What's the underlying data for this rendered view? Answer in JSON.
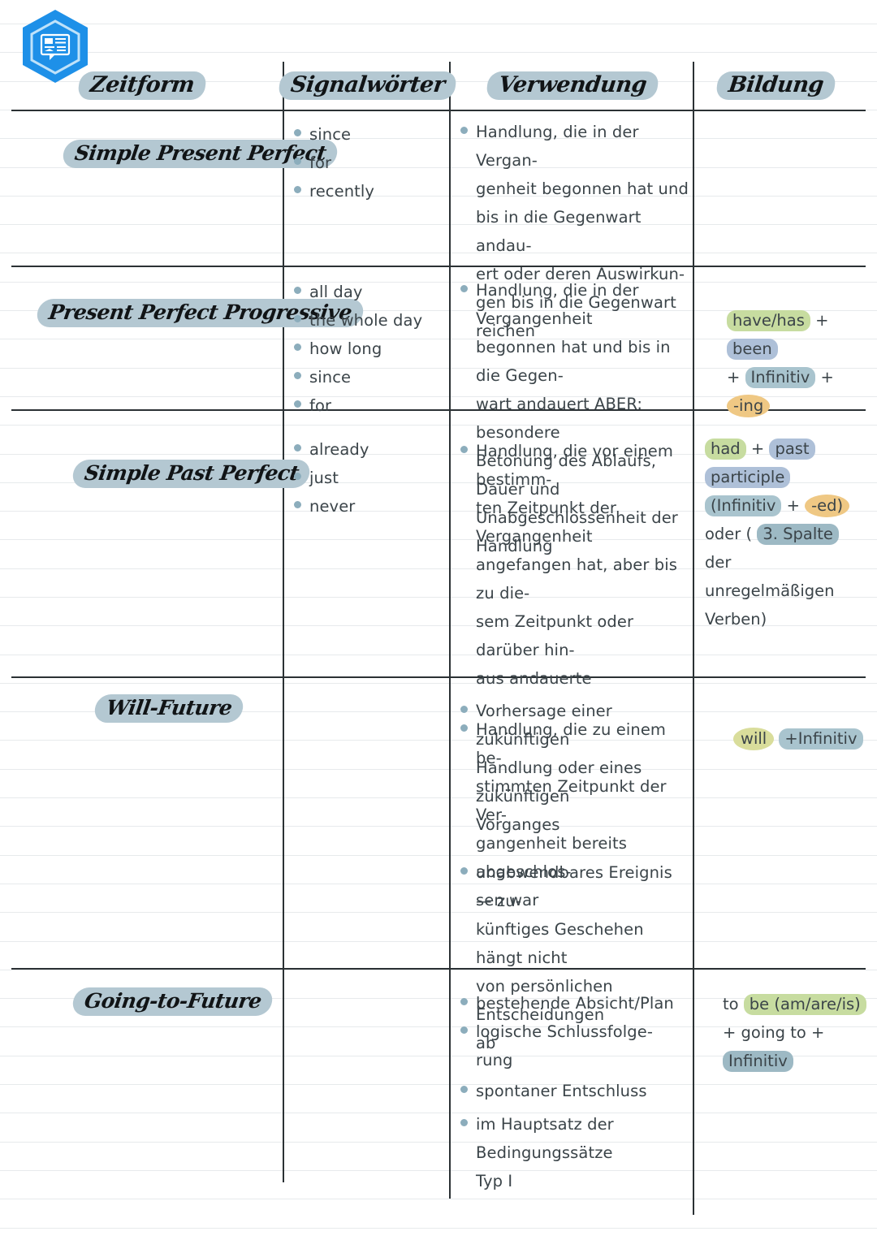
{
  "logo": {
    "icon": "hexagon-note-icon",
    "color": "#1e90e8"
  },
  "table": {
    "headers": [
      {
        "label": "Zeitform"
      },
      {
        "label": "Signalwörter"
      },
      {
        "label": "Verwendung"
      },
      {
        "label": "Bildung"
      }
    ],
    "rows": [
      {
        "tense": "Simple Present Perfect",
        "signalwoerter": [
          "since",
          "for",
          "recently"
        ],
        "verwendung": [
          "Handlung, die in der Vergan-\ngenheit begonnen hat und\nbis in die Gegenwart andau-\nert oder deren Auswirkun-\ngen bis in die Gegenwart\nreichen"
        ],
        "bildung": []
      },
      {
        "tense": "Present Perfect Progressive",
        "signalwoerter": [
          "all day",
          "the whole day",
          "how long",
          "since",
          "for"
        ],
        "verwendung": [
          "Handlung, die in der Vergangenheit\nbegonnen hat und bis in die Gegen-\nwart andauert ABER: besondere\nBetonung des Ablaufs, Dauer und\nUnabgeschlossenheit der Handlung"
        ],
        "bildung": [
          [
            {
              "text": "have/has",
              "hl": "green"
            },
            {
              "text": "+",
              "hl": "none"
            },
            {
              "text": "been",
              "hl": "blue"
            }
          ],
          [
            {
              "text": "+",
              "hl": "none"
            },
            {
              "text": "Infinitiv",
              "hl": "steel"
            },
            {
              "text": "+",
              "hl": "none"
            },
            {
              "text": "-ing",
              "hl": "orange"
            }
          ]
        ]
      },
      {
        "tense": "Simple Past Perfect",
        "signalwoerter": [
          "already",
          "just",
          "never"
        ],
        "verwendung": [
          "Handlung, die vor einem bestimm-\nten Zeitpunkt der Vergangenheit\nangefangen hat, aber bis zu die-\nsem Zeitpunkt oder darüber hin-\naus andauerte",
          "Handlung, die zu einem be-\nstimmten Zeitpunkt der Ver-\ngangenheit bereits abgeschlos-\nsen war"
        ],
        "bildung": [
          [
            {
              "text": "had",
              "hl": "green"
            },
            {
              "text": "+",
              "hl": "none"
            },
            {
              "text": "past",
              "hl": "blue"
            }
          ],
          [
            {
              "text": "participle",
              "hl": "blue"
            }
          ],
          [
            {
              "text": "(Infinitiv",
              "hl": "steel"
            },
            {
              "text": "+",
              "hl": "none"
            },
            {
              "text": "-ed)",
              "hl": "orange"
            }
          ],
          [
            {
              "text": "oder (",
              "hl": "none"
            },
            {
              "text": "3. Spalte",
              "hl": "dark"
            }
          ],
          [
            {
              "text": "der",
              "hl": "none"
            }
          ],
          [
            {
              "text": "unregelmäßigen",
              "hl": "none"
            }
          ],
          [
            {
              "text": "Verben)",
              "hl": "none"
            }
          ]
        ]
      },
      {
        "tense": "Will-Future",
        "signalwoerter": [],
        "verwendung": [
          "Vorhersage einer zukünftigen\nHandlung oder eines zukünftigen\nVorganges",
          "unabwendbares Ereignis — zu-\nkünftiges Geschehen hängt nicht\nvon persönlichen Entscheidungen\nab",
          "spontaner Entschluss",
          "im Hauptsatz der Bedingungssätze\nTyp I"
        ],
        "bildung": [
          [
            {
              "text": "will",
              "hl": "olive"
            },
            {
              "text": "+Infinitiv",
              "hl": "steel"
            }
          ]
        ]
      },
      {
        "tense": "Going-to-Future",
        "signalwoerter": [],
        "verwendung": [
          "bestehende Absicht/Plan",
          "logische Schlussfolge-\nrung"
        ],
        "bildung": [
          [
            {
              "text": "to ",
              "hl": "none"
            },
            {
              "text": "be (am/are/is)",
              "hl": "green"
            }
          ],
          [
            {
              "text": "+ going to +",
              "hl": "none"
            }
          ],
          [
            {
              "text": "Infinitiv",
              "hl": "dark"
            }
          ]
        ]
      }
    ]
  },
  "colors": {
    "pill": "#b4c8d2",
    "bullet": "#8cadbc",
    "green": "#c7dca0",
    "blue": "#aec0d8",
    "steel": "#a9c4ce",
    "orange": "#efc884",
    "olive": "#d9dd9b",
    "dark": "#9db9c4",
    "rule": "#e7eaec",
    "divider": "#2b3134",
    "logo": "#1e90e8"
  }
}
